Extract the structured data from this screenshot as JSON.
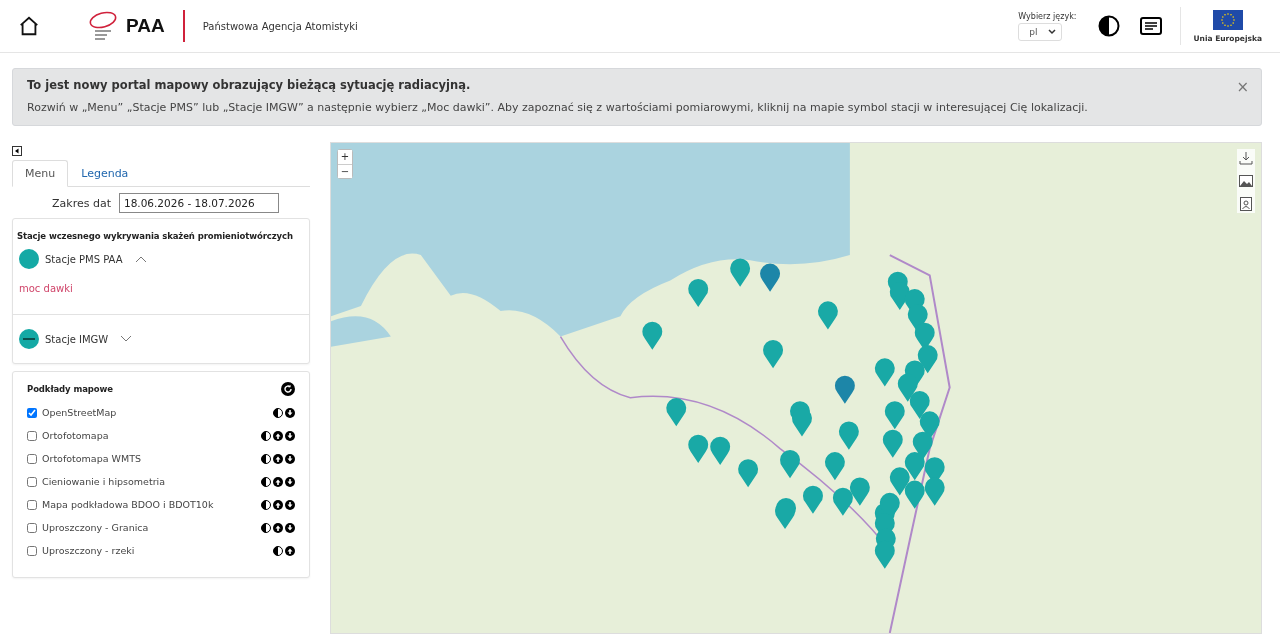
{
  "header": {
    "logo_text": "PAA",
    "agency": "Państwowa Agencja Atomistyki",
    "language_label": "Wybierz język:",
    "language": "pl",
    "eu_label": "Unia Europejska"
  },
  "alert": {
    "title": "To jest nowy portal mapowy obrazujący bieżącą sytuację radiacyjną.",
    "text": "Rozwiń w „Menu” „Stacje PMS” lub „Stacje IMGW” a następnie wybierz „Moc dawki”. Aby zapoznać się z wartościami pomiarowymi, kliknij na mapie symbol stacji w interesującej Cię lokalizacji.",
    "close": "×"
  },
  "tabs": [
    {
      "label": "Menu",
      "selected": true
    },
    {
      "label": "Legenda",
      "selected": false
    }
  ],
  "date_range": {
    "label": "Zakres dat",
    "value": "18.06.2026 - 18.07.2026"
  },
  "stations": {
    "title": "Stacje wczesnego wykrywania skażeń promieniotwórczych",
    "groups": [
      {
        "name": "Stacje PMS PAA",
        "expanded": true,
        "items": [
          "moc dawki"
        ]
      },
      {
        "name": "Stacje IMGW",
        "expanded": false
      }
    ]
  },
  "layers": {
    "title": "Podkłady mapowe",
    "items": [
      {
        "name": "OpenStreetMap",
        "checked": true,
        "up": false,
        "down": true
      },
      {
        "name": "Ortofotomapa",
        "checked": false,
        "up": true,
        "down": true
      },
      {
        "name": "Ortofotomapa WMTS",
        "checked": false,
        "up": true,
        "down": true
      },
      {
        "name": "Cieniowanie i hipsometria",
        "checked": false,
        "up": true,
        "down": true
      },
      {
        "name": "Mapa podkładowa BDOO i BDOT10k",
        "checked": false,
        "up": true,
        "down": true
      },
      {
        "name": "Uproszczony - Granica",
        "checked": false,
        "up": true,
        "down": true
      },
      {
        "name": "Uproszczony - rzeki",
        "checked": false,
        "up": true,
        "down": false
      }
    ]
  },
  "map": {
    "zoom_in": "+",
    "zoom_out": "−"
  }
}
